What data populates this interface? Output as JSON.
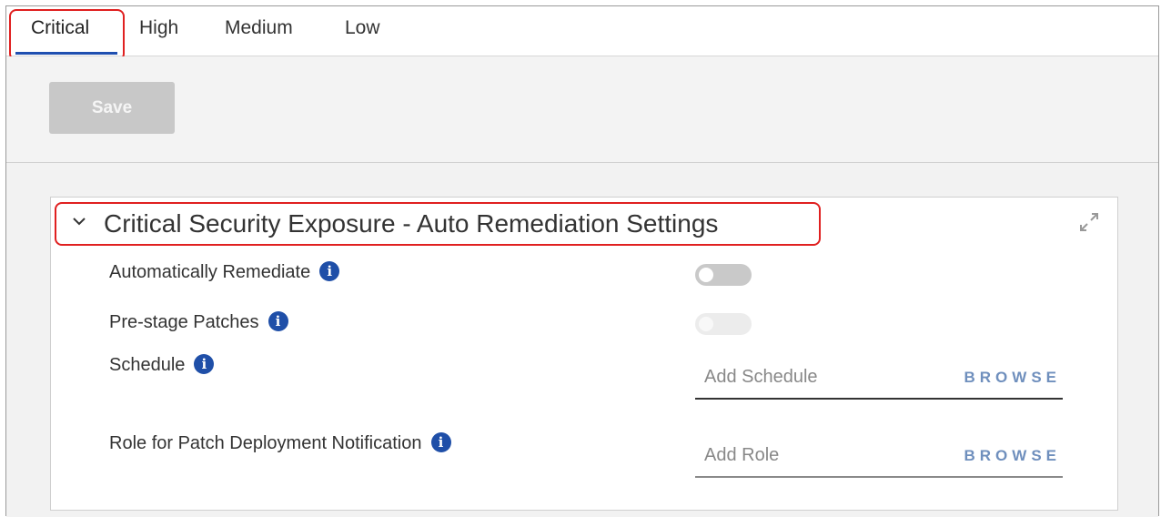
{
  "tabs": [
    {
      "label": "Critical",
      "active": true
    },
    {
      "label": "High",
      "active": false
    },
    {
      "label": "Medium",
      "active": false
    },
    {
      "label": "Low",
      "active": false
    }
  ],
  "toolbar": {
    "save_label": "Save",
    "save_enabled": false
  },
  "section": {
    "title": "Critical Security Exposure - Auto Remediation Settings",
    "collapse_icon": "chevron-down-icon",
    "expand_icon": "expand-icon"
  },
  "settings": {
    "auto_remediate": {
      "label": "Automatically Remediate",
      "enabled": false
    },
    "prestage": {
      "label": "Pre-stage Patches",
      "enabled": false,
      "disabled": true
    },
    "schedule": {
      "label": "Schedule",
      "placeholder": "Add Schedule",
      "browse": "BROWSE"
    },
    "role": {
      "label": "Role for Patch Deployment Notification",
      "placeholder": "Add Role",
      "browse": "BROWSE"
    }
  },
  "colors": {
    "accent": "#1f4fb0",
    "highlight": "#e02020",
    "info": "#1f4fa8",
    "browse": "#6f8fbd"
  }
}
